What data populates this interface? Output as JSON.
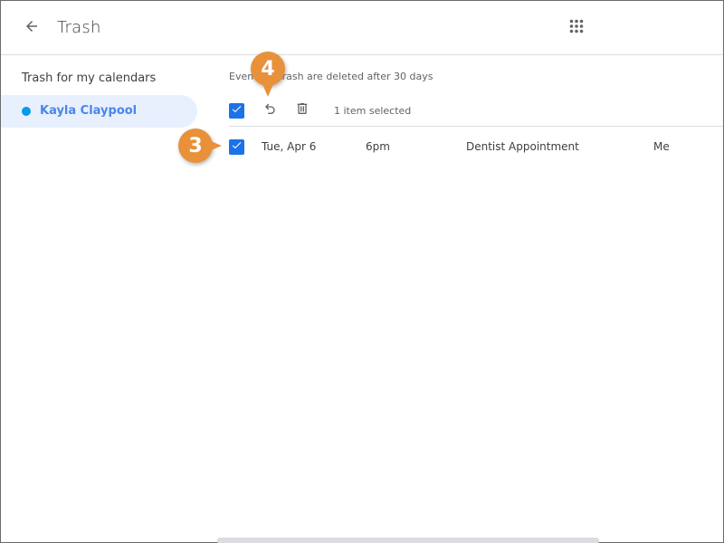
{
  "header": {
    "title": "Trash",
    "back_icon": "arrow-left-icon",
    "apps_icon": "apps-grid-icon"
  },
  "sidebar": {
    "heading": "Trash for my calendars",
    "items": [
      {
        "label": "Kayla Claypool",
        "color": "#039be5",
        "selected": true
      }
    ]
  },
  "main": {
    "notice": "Events in trash are deleted after 30 days",
    "toolbar": {
      "select_all_checked": true,
      "restore_icon": "undo-icon",
      "delete_icon": "trash-icon",
      "selection_status": "1 item selected"
    },
    "rows": [
      {
        "checked": true,
        "date": "Tue, Apr 6",
        "time": "6pm",
        "title": "Dentist Appointment",
        "owner": "Me"
      }
    ]
  },
  "callouts": [
    {
      "number": "3",
      "target": "row-checkbox"
    },
    {
      "number": "4",
      "target": "restore-button"
    }
  ],
  "colors": {
    "accent": "#1a73e8",
    "selected_bg": "#e8f0fe",
    "selected_text": "#4a86e8",
    "callout": "#e8913a"
  }
}
